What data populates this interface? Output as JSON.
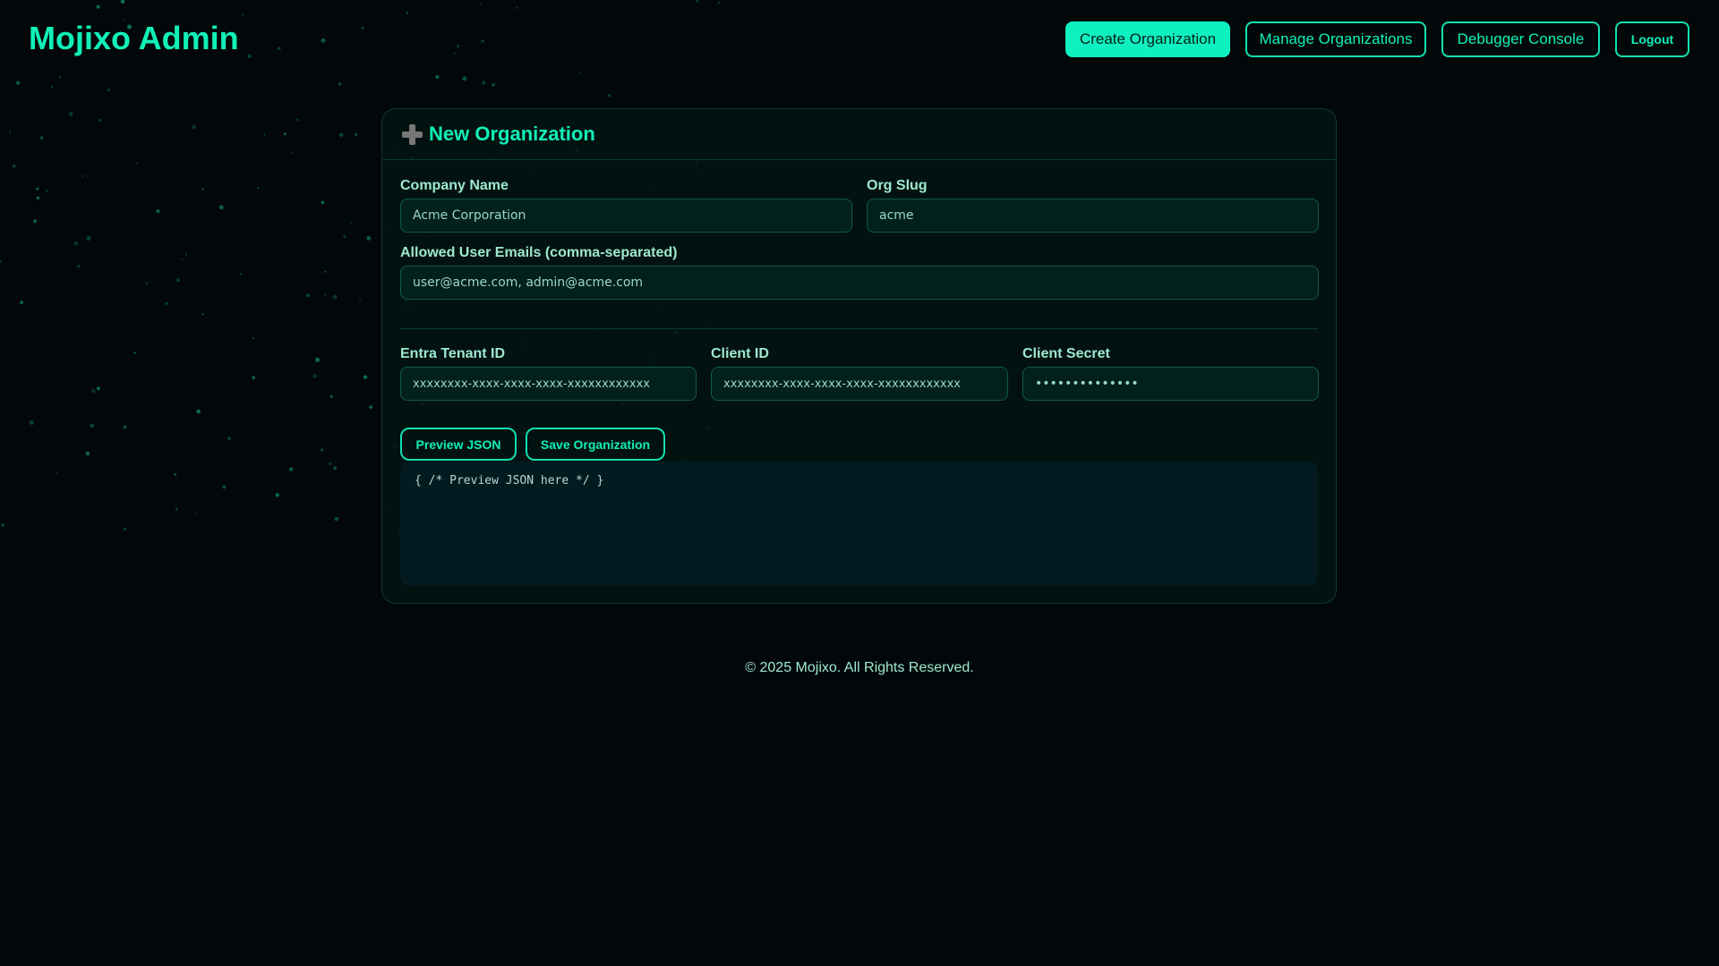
{
  "header": {
    "brand": "Mojixo Admin",
    "nav": [
      "Create Organization",
      "Manage Organizations",
      "Debugger Console",
      "Logout"
    ]
  },
  "card": {
    "icon": "plus-icon",
    "title": "New Organization",
    "company_name": {
      "label": "Company Name",
      "value": "Acme Corporation"
    },
    "org_slug": {
      "label": "Org Slug",
      "value": "acme"
    },
    "emails": {
      "label": "Allowed User Emails (comma-separated)",
      "value": "user@acme.com, admin@acme.com"
    },
    "tenant_id": {
      "label": "Entra Tenant ID",
      "value": "xxxxxxxx-xxxx-xxxx-xxxx-xxxxxxxxxxxx"
    },
    "client_id": {
      "label": "Client ID",
      "value": "xxxxxxxx-xxxx-xxxx-xxxx-xxxxxxxxxxxx"
    },
    "client_secret": {
      "label": "Client Secret",
      "value": "••••••••••••••"
    },
    "preview_button": "Preview JSON",
    "save_button": "Save Organization",
    "preview_output": "{ /* Preview JSON here */ }"
  },
  "footer": "© 2025 Mojixo. All Rights Reserved.",
  "colors": {
    "accent": "#10f0b8",
    "background": "#02080a"
  }
}
